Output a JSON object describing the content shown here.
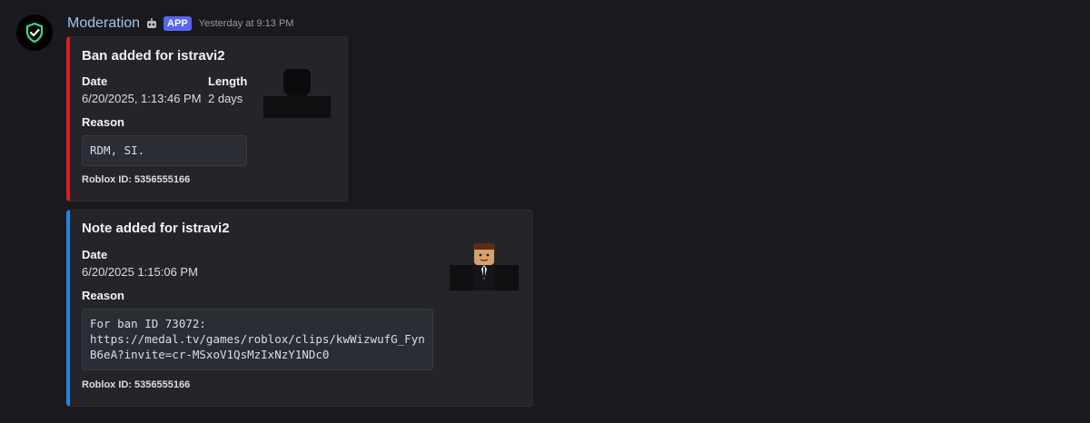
{
  "message": {
    "author": "Moderation",
    "app_tag": "APP",
    "timestamp": "Yesterday at 9:13 PM",
    "bot_icon": "robot-icon",
    "avatar_icon": "shield-check-icon"
  },
  "embeds": [
    {
      "accent_color": "#e01b24",
      "title": "Ban added for istravi2",
      "fields": [
        {
          "name": "Date",
          "value": "6/20/2025, 1:13:46 PM"
        },
        {
          "name": "Length",
          "value": "2 days"
        },
        {
          "name": "Reason",
          "value": "RDM, SI."
        }
      ],
      "footer": "Roblox ID: 5356555166"
    },
    {
      "accent_color": "#1e88e5",
      "title": "Note added for istravi2",
      "fields": [
        {
          "name": "Date",
          "value": "6/20/2025 1:15:06 PM"
        },
        {
          "name": "Reason",
          "value": "For ban ID 73072:\nhttps://medal.tv/games/roblox/clips/kwWizwufG_FynB6eA?invite=cr-MSxoV1QsMzIxNzY1NDc0"
        }
      ],
      "footer": "Roblox ID: 5356555166"
    }
  ]
}
